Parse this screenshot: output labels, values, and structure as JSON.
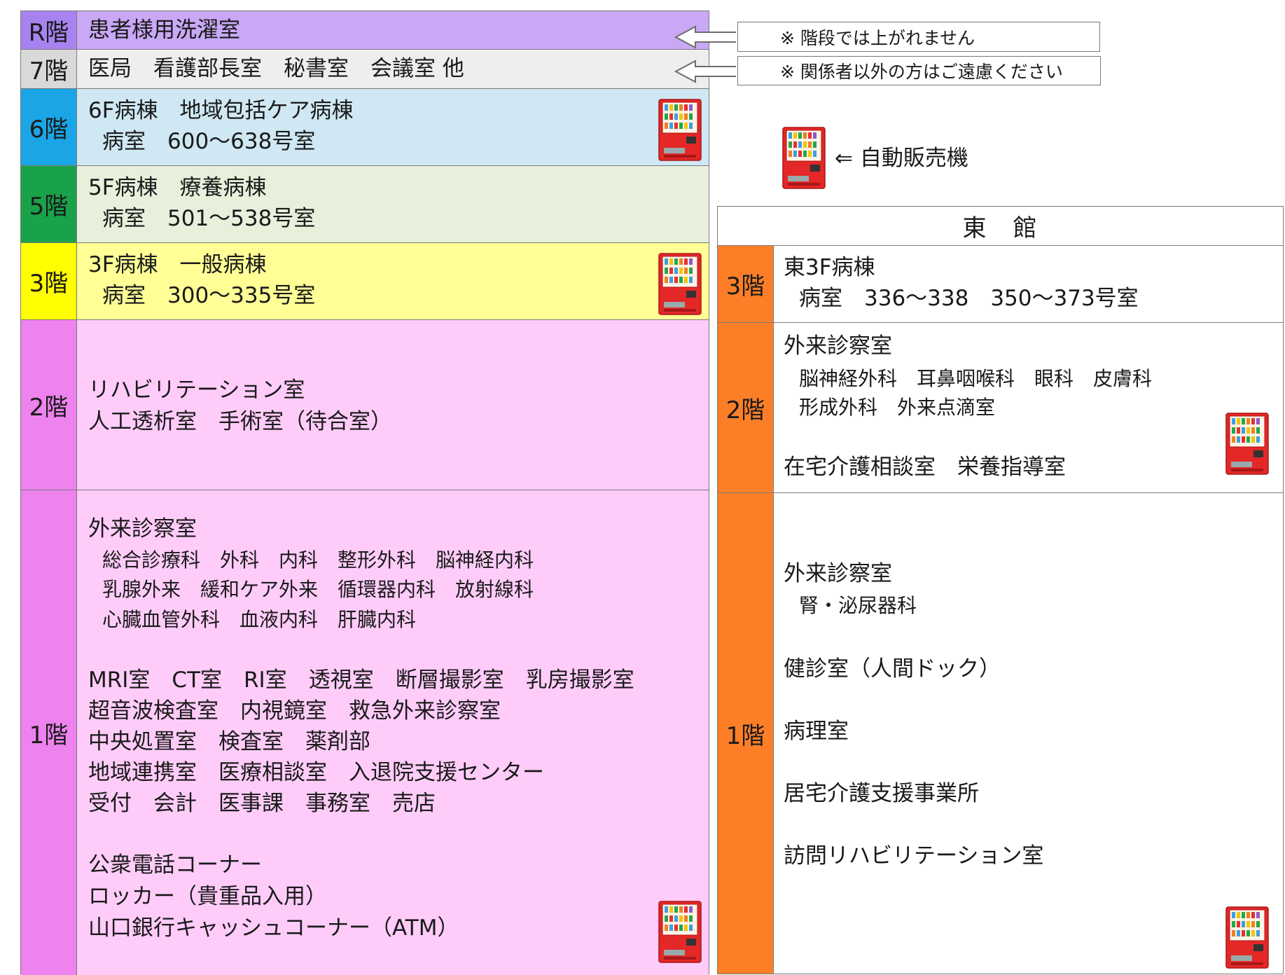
{
  "colors": {
    "r": "#c9a8f5",
    "f7": "#eeeeee",
    "f6": "#cfe8f3",
    "f5": "#e8f0dc",
    "f3": "#ffff96",
    "pink": "#ffccf9",
    "label6": "#1aa6e6",
    "label5": "#1aa24a",
    "label3": "#ffff00",
    "label2": "#ee82ee",
    "labelR": "#a783f0",
    "eastLabel": "#fc7f28",
    "vending": "#e42727"
  },
  "main": {
    "floors": [
      {
        "key": "R",
        "label": "R階",
        "lines": [
          "患者様用洗濯室"
        ]
      },
      {
        "key": "7",
        "label": "7階",
        "lines": [
          "医局　看護部長室　秘書室　会議室 他"
        ]
      },
      {
        "key": "6",
        "label": "6階",
        "lines": [
          "6F病棟　地域包括ケア病棟",
          "病室　600～638号室"
        ]
      },
      {
        "key": "5",
        "label": "5階",
        "lines": [
          "5F病棟　療養病棟",
          "病室　501～538号室"
        ]
      },
      {
        "key": "3",
        "label": "3階",
        "lines": [
          "3F病棟　一般病棟",
          "病室　300～335号室"
        ]
      },
      {
        "key": "2",
        "label": "2階",
        "lines": [
          "リハビリテーション室",
          "人工透析室　手術室（待合室）"
        ]
      },
      {
        "key": "1",
        "label": "1階",
        "lines": [
          "外来診察室",
          "総合診療科　外科　内科　整形外科　脳神経内科",
          "乳腺外来　緩和ケア外来　循環器内科　放射線科",
          "心臓血管外科　血液内科　肝臓内科",
          "MRI室　CT室　RI室　透視室　断層撮影室　乳房撮影室",
          "超音波検査室　内視鏡室　救急外来診察室",
          "中央処置室　検査室　薬剤部",
          "地域連携室　医療相談室　入退院支援センター",
          "受付　会計　医事課　事務室　売店",
          "公衆電話コーナー",
          "ロッカー（貴重品入用）",
          "山口銀行キャッシュコーナー（ATM）"
        ]
      }
    ]
  },
  "notes": {
    "r": "※ 階段では上がれません",
    "f7": "※ 関係者以外の方はご遠慮ください"
  },
  "legend": {
    "label": "⇐ 自動販売機",
    "icon": "vending-machine-icon"
  },
  "east": {
    "title": "東　館",
    "floors": [
      {
        "key": "3",
        "label": "3階",
        "lines": [
          "東3F病棟",
          "病室　336～338　350～373号室"
        ]
      },
      {
        "key": "2",
        "label": "2階",
        "lines": [
          "外来診察室",
          "脳神経外科　耳鼻咽喉科　眼科　皮膚科",
          "形成外科　外来点滴室",
          "在宅介護相談室　栄養指導室"
        ]
      },
      {
        "key": "1",
        "label": "1階",
        "lines": [
          "外来診察室",
          "腎・泌尿器科",
          "健診室（人間ドック）",
          "病理室",
          "居宅介護支援事業所",
          "訪問リハビリテーション室"
        ]
      }
    ]
  }
}
